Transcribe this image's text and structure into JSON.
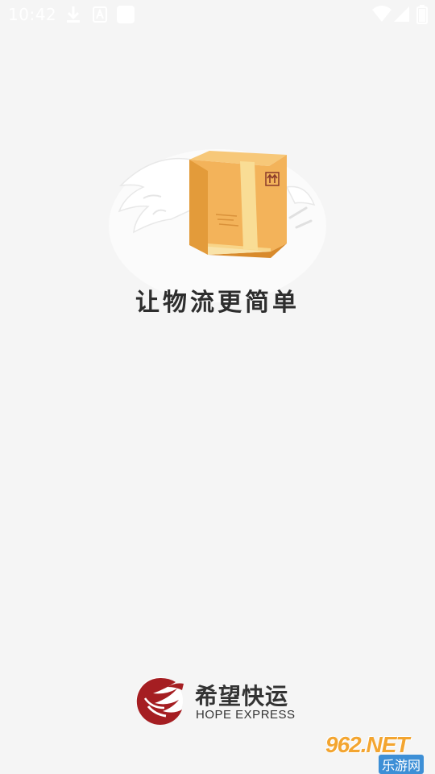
{
  "status_bar": {
    "time": "10:42",
    "left_icons": [
      "download-icon",
      "a11y-icon",
      "app-icon"
    ],
    "right_icons": [
      "wifi-icon",
      "signal-icon",
      "battery-icon"
    ]
  },
  "splash": {
    "slogan": "让物流更简单",
    "illustration": "winged-box"
  },
  "brand": {
    "name_cn": "希望快运",
    "name_en": "HOPE EXPRESS",
    "logo_color": "#a51e22"
  },
  "watermark": {
    "main": "962.NET",
    "sub": "乐游网"
  },
  "colors": {
    "background": "#f5f5f5",
    "box_orange": "#f3b35a",
    "brand_red": "#a51e22"
  }
}
